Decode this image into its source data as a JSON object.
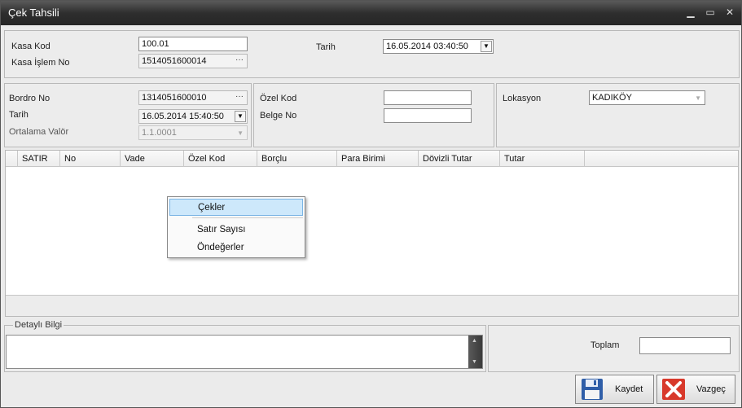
{
  "window": {
    "title": "Çek Tahsili",
    "min": "▁",
    "max": "▭",
    "close": "✕"
  },
  "top": {
    "kasa_kod_label": "Kasa Kod",
    "kasa_kod_value": "100.01",
    "kasa_islem_label": "Kasa İşlem No",
    "kasa_islem_value": "1514051600014",
    "tarih_label": "Tarih",
    "tarih_value": "16.05.2014 03:40:50"
  },
  "bordro": {
    "bordro_label": "Bordro No",
    "bordro_value": "1314051600010",
    "tarih_label": "Tarih",
    "tarih_value": "16.05.2014 15:40:50",
    "valor_label": "Ortalama Valör",
    "valor_value": "1.1.0001"
  },
  "ozel": {
    "ozel_label": "Özel Kod",
    "ozel_value": "",
    "belge_label": "Belge No",
    "belge_value": ""
  },
  "lokasyon": {
    "label": "Lokasyon",
    "value": "KADIKÖY"
  },
  "grid": {
    "columns": [
      "SATIR",
      "No",
      "Vade",
      "Özel Kod",
      "Borçlu",
      "Para Birimi",
      "Dövizli Tutar",
      "Tutar"
    ]
  },
  "context_menu": {
    "items": [
      "Çekler",
      "Satır Sayısı",
      "Öndeğerler"
    ]
  },
  "detail": {
    "label": "Detaylı Bilgi",
    "value": ""
  },
  "total": {
    "label": "Toplam",
    "value": ""
  },
  "buttons": {
    "save": "Kaydet",
    "cancel": "Vazgeç"
  },
  "colors": {
    "title_bar": "#2e2e2e",
    "menu_highlight": "#cde8fb",
    "cancel_icon": "#d8392b",
    "save_icon": "#2f5ea8"
  }
}
